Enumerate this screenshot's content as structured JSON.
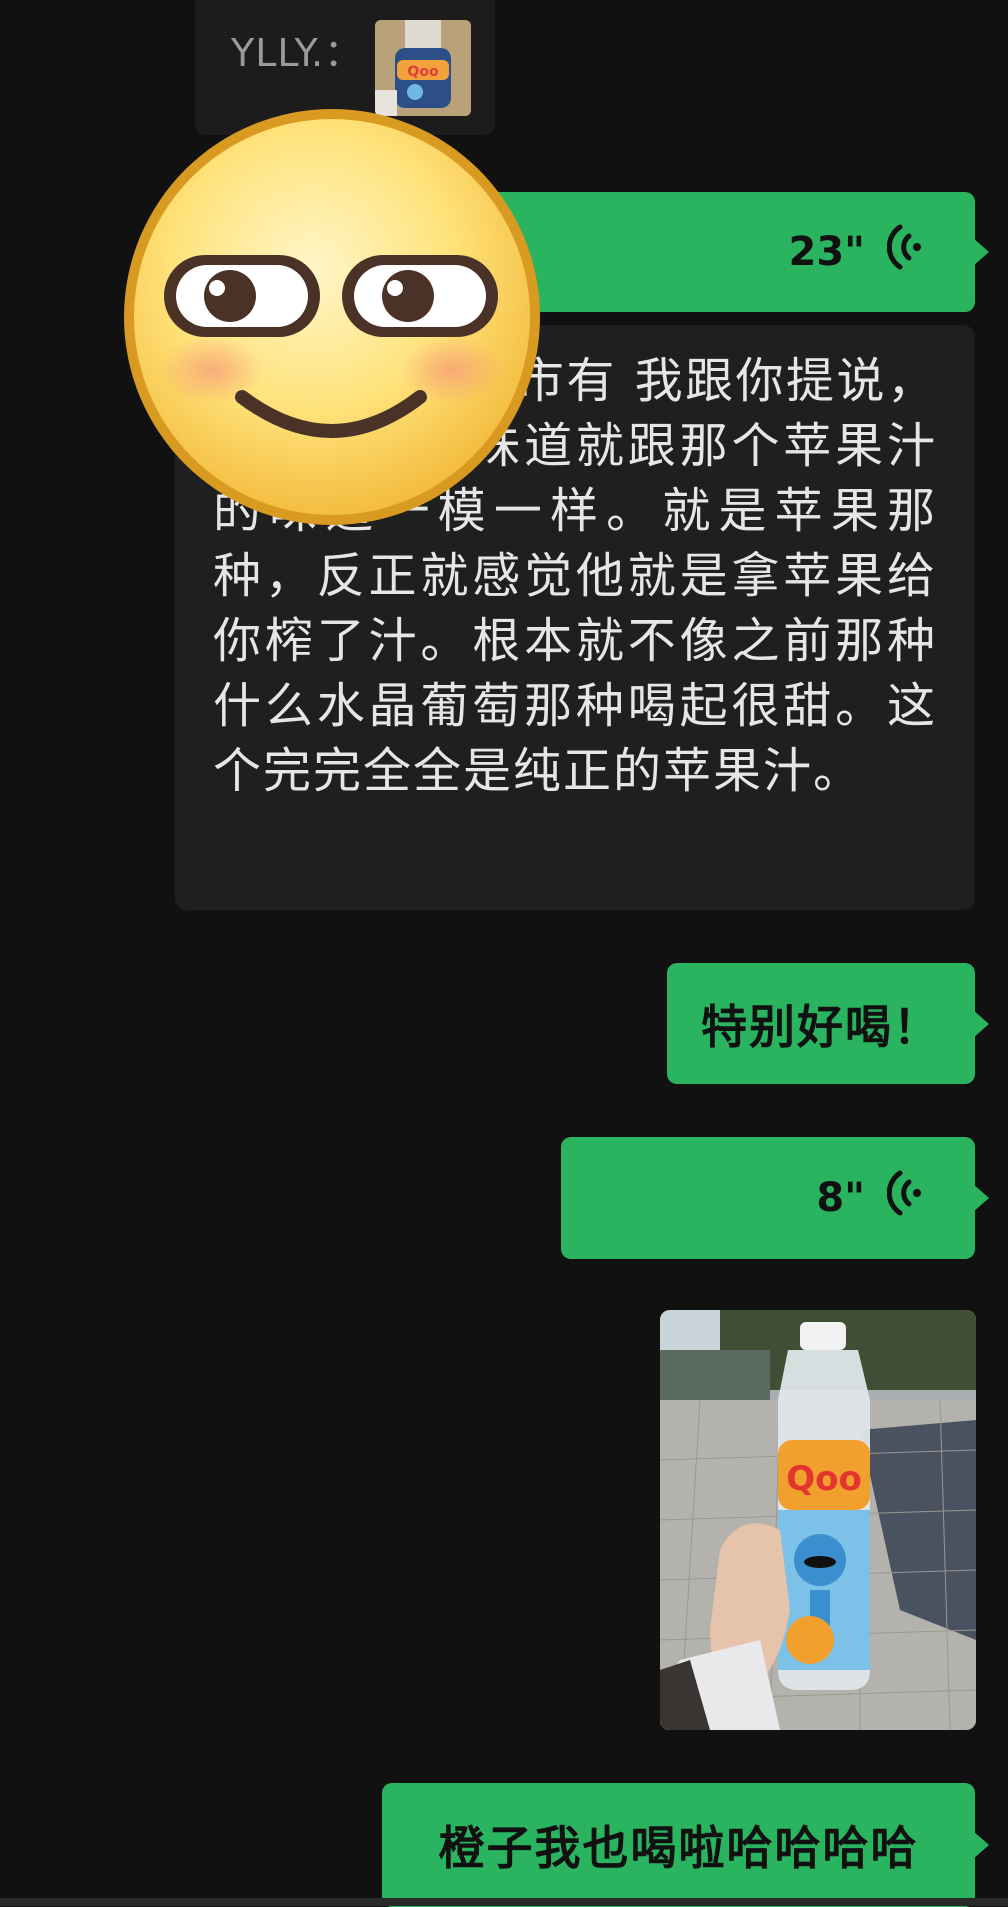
{
  "quote": {
    "sender": "YLLY.：",
    "thumbnail_icon": "qoo-bottle-thumbnail"
  },
  "messages": [
    {
      "type": "voice",
      "duration": "23\"",
      "icon": "voice-wave-icon"
    },
    {
      "type": "transcript",
      "text": "你去看你们超市有 我跟你提说，就是这个的味道就跟那个苹果汁的味道一模一样。就是苹果那种，反正就感觉他就是拿苹果给你榨了汁。根本就不像之前那种什么水晶葡萄那种喝起很甜。这个完完全全是纯正的苹果汁。"
    },
    {
      "type": "text",
      "text": "特别好喝！"
    },
    {
      "type": "voice",
      "duration": "8\"",
      "icon": "voice-wave-icon"
    },
    {
      "type": "image",
      "alt_icon": "qoo-juice-bottle-photo"
    },
    {
      "type": "text",
      "text": "橙子我也喝啦哈哈哈哈"
    }
  ],
  "sticker": {
    "icon": "smirk-emoji-sticker"
  },
  "colors": {
    "background": "#111111",
    "green_bubble": "#2ab45f",
    "grey_bubble": "#1f1f1f"
  }
}
